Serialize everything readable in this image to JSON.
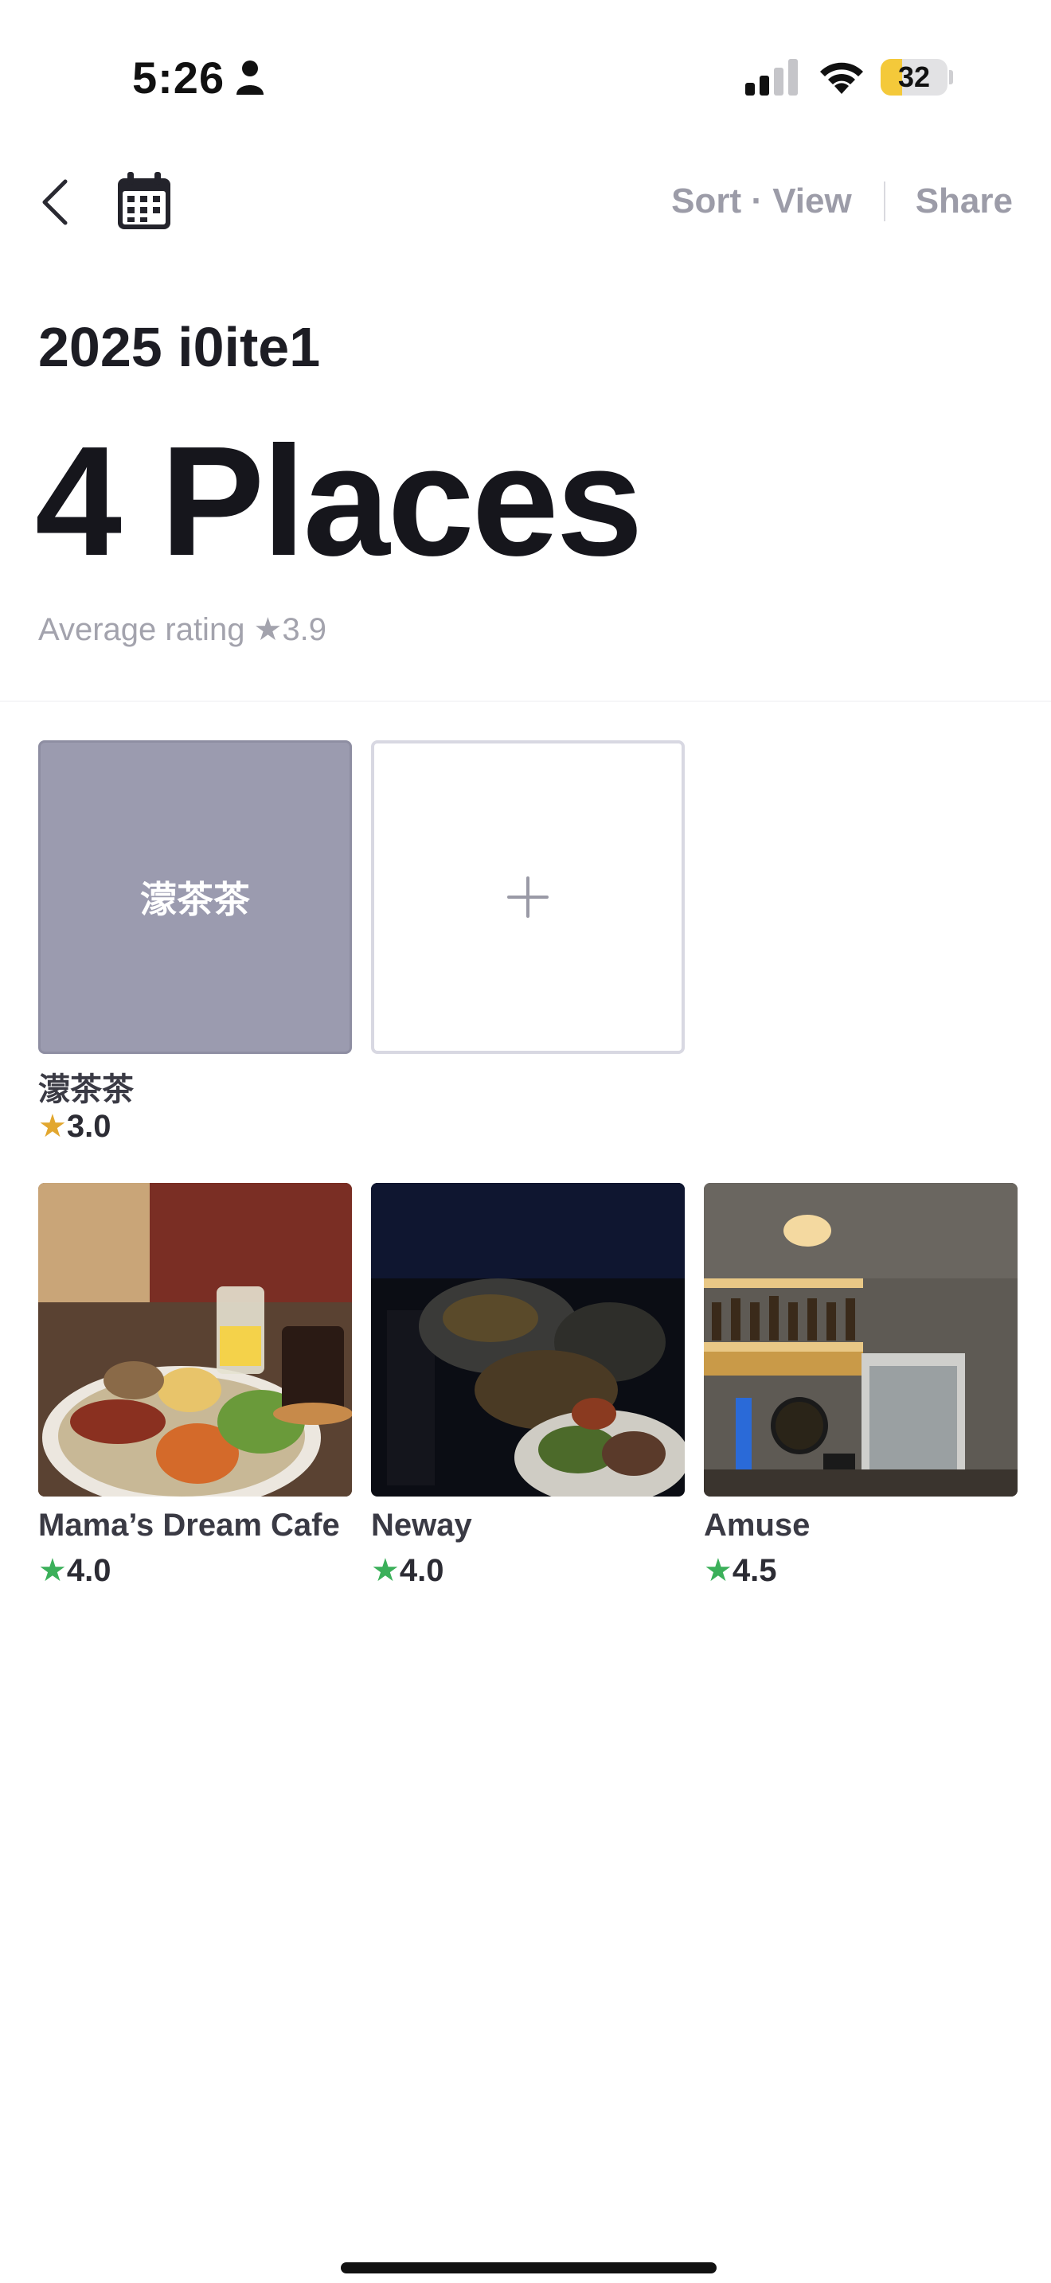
{
  "status_bar": {
    "time": "5:26",
    "battery": "32",
    "battery_level": 0.32,
    "icons": [
      "person-icon",
      "signal-icon",
      "wifi-icon",
      "battery-icon"
    ]
  },
  "nav": {
    "back_icon": "chevron-left-icon",
    "calendar_icon": "calendar-icon",
    "sort_view": "Sort · View",
    "share": "Share"
  },
  "header": {
    "subtitle": "2025 i0ite1",
    "title": "4 Places",
    "average_rating": "Average rating ★3.9"
  },
  "places": [
    {
      "name": "濛茶茶",
      "thumb_text": "濛茶茶",
      "rating": "3.0",
      "star_color": "#e2a72f"
    },
    {
      "name": "Mama’s Dream Cafe",
      "rating": "4.0",
      "star_color": "#3bb05a"
    },
    {
      "name": "Neway",
      "rating": "4.0",
      "star_color": "#3bb05a"
    },
    {
      "name": "Amuse",
      "rating": "4.5",
      "star_color": "#3bb05a"
    }
  ],
  "add_tile": {
    "icon": "plus-icon"
  },
  "star_glyph": "★"
}
